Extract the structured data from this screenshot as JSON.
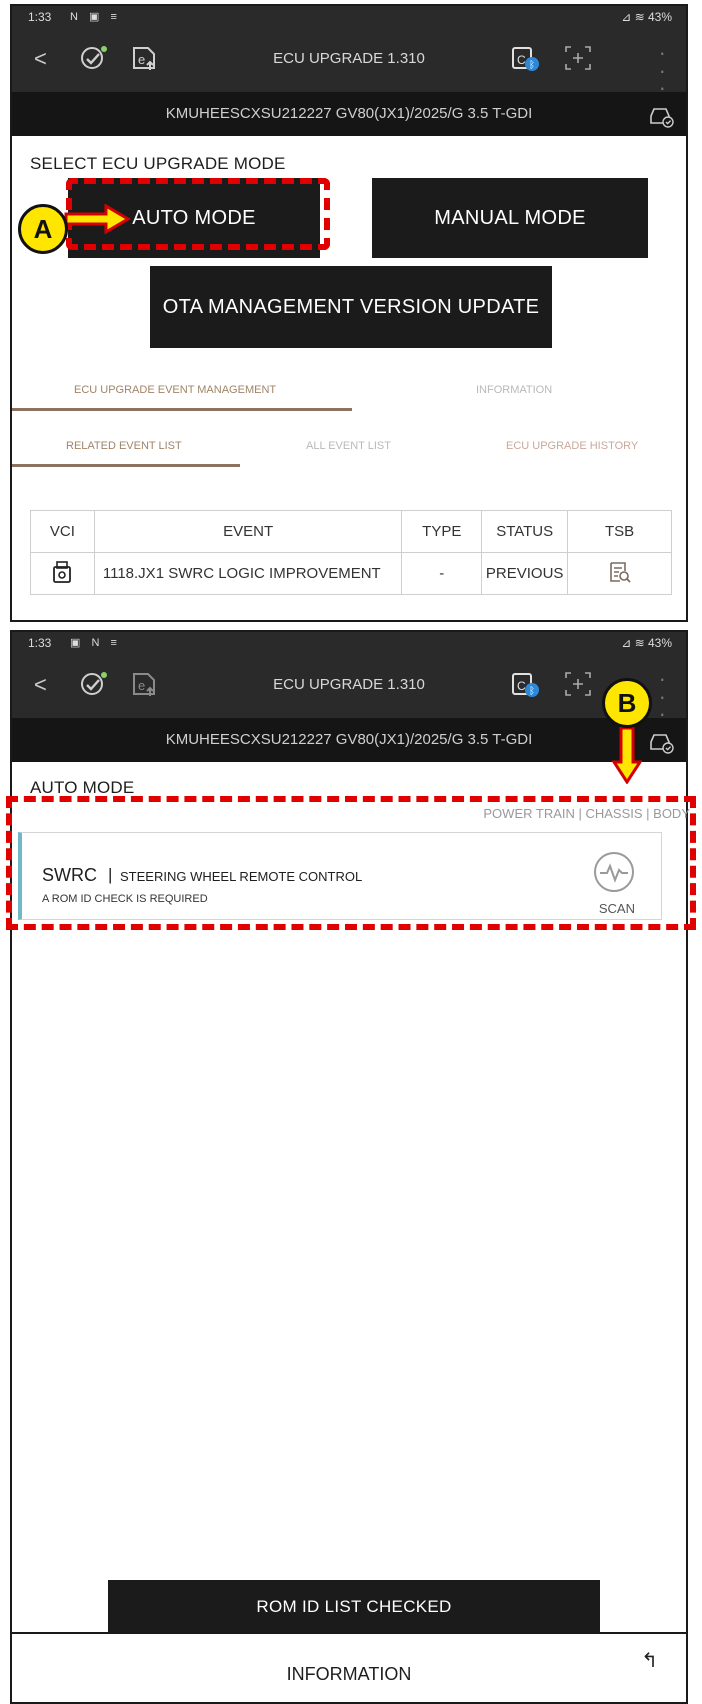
{
  "top": {
    "status": {
      "time": "1:33",
      "icons": "N ▣ ≡",
      "right": "⊿ ≋ 43%"
    },
    "appbar": {
      "title": "ECU UPGRADE 1.310"
    },
    "vin": "KMUHEESCXSU212227  GV80(JX1)/2025/G 3.5 T-GDI",
    "section_title": "SELECT ECU UPGRADE MODE",
    "buttons": {
      "auto": "AUTO MODE",
      "manual": "MANUAL MODE",
      "ota": "OTA MANAGEMENT VERSION UPDATE"
    },
    "tabs1": [
      "ECU UPGRADE EVENT MANAGEMENT",
      "INFORMATION"
    ],
    "tabs2": [
      "RELATED EVENT LIST",
      "ALL EVENT LIST",
      "ECU UPGRADE HISTORY"
    ],
    "table": {
      "headers": [
        "VCI",
        "EVENT",
        "TYPE",
        "STATUS",
        "TSB"
      ],
      "rows": [
        {
          "event": "1118.JX1 SWRC LOGIC IMPROVEMENT",
          "type": "-",
          "status": "PREVIOUS"
        }
      ]
    }
  },
  "bottom": {
    "status": {
      "time": "1:33",
      "icons": "▣ N ≡",
      "right": "⊿ ≋ 43%"
    },
    "appbar": {
      "title": "ECU UPGRADE 1.310"
    },
    "vin": "KMUHEESCXSU212227  GV80(JX1)/2025/G 3.5 T-GDI",
    "section_title": "AUTO MODE",
    "modes": "POWER TRAIN  |  CHASSIS  |  BODY",
    "card": {
      "code": "SWRC",
      "sep": "|",
      "name": "STEERING WHEEL REMOTE CONTROL",
      "note": "A ROM ID CHECK IS REQUIRED",
      "scan": "SCAN"
    },
    "rom_button": "ROM ID LIST CHECKED",
    "info_label": "INFORMATION"
  },
  "callouts": {
    "a": "A",
    "b": "B"
  },
  "colors": {
    "highlight": "#e00000",
    "callout_fill": "#ffe600",
    "accent_tab": "#8c7260",
    "card_accent": "#6fb8c4"
  }
}
